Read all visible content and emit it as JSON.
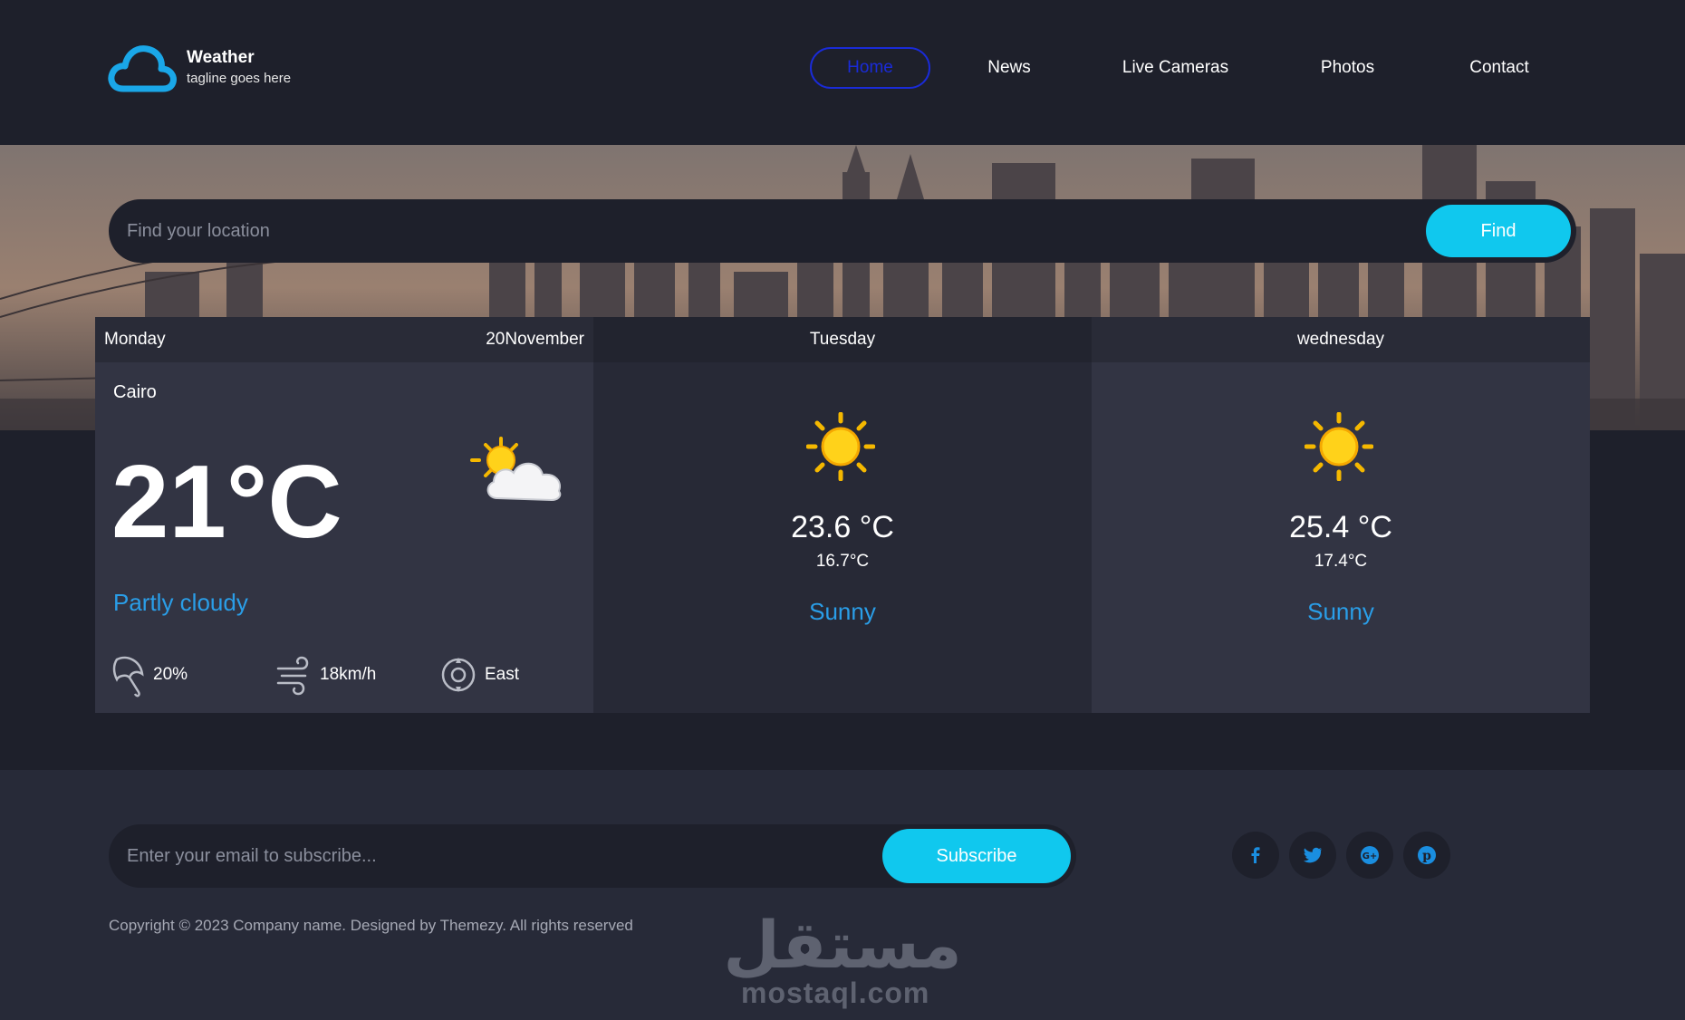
{
  "brand": {
    "title": "Weather",
    "tagline": "tagline goes here"
  },
  "nav": {
    "items": [
      {
        "label": "Home",
        "active": true
      },
      {
        "label": "News"
      },
      {
        "label": "Live Cameras"
      },
      {
        "label": "Photos"
      },
      {
        "label": "Contact"
      }
    ]
  },
  "search": {
    "placeholder": "Find your location",
    "button": "Find"
  },
  "today": {
    "day": "Monday",
    "date": "20November",
    "city": "Cairo",
    "temp": "21°C",
    "icon": "partly-cloudy-icon",
    "condition": "Partly cloudy",
    "rain": "20%",
    "wind": "18km/h",
    "direction": "East"
  },
  "days": [
    {
      "day": "Tuesday",
      "max": "23.6 °C",
      "min": "16.7°C",
      "condition": "Sunny",
      "icon": "sun-icon"
    },
    {
      "day": "wednesday",
      "max": "25.4 °C",
      "min": "17.4°C",
      "condition": "Sunny",
      "icon": "sun-icon"
    }
  ],
  "subscribe": {
    "placeholder": "Enter your email to subscribe...",
    "button": "Subscribe"
  },
  "socials": [
    "facebook-icon",
    "twitter-icon",
    "google-plus-icon",
    "pinterest-icon"
  ],
  "copyright": "Copyright © 2023 Company name. Designed by Themezy. All rights reserved",
  "watermark": {
    "arabic": "مستقل",
    "latin": "mostaql.com"
  },
  "colors": {
    "accent": "#10c8ee",
    "condition": "#2a9ee8",
    "nav_active": "#1a2bd8",
    "background": "#1e202b"
  }
}
